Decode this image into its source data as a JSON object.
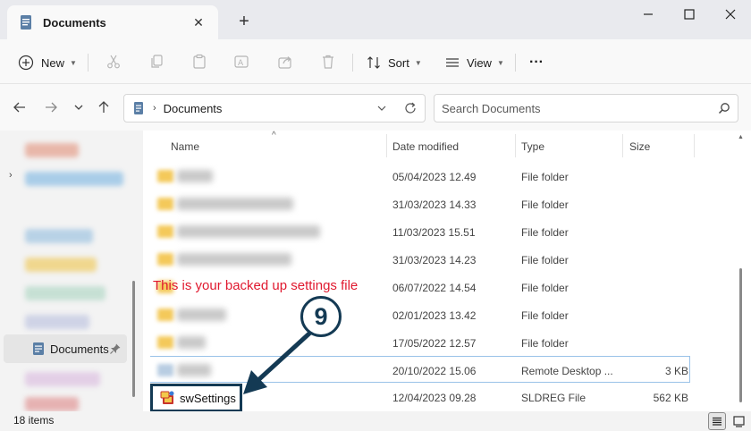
{
  "window": {
    "tab_title": "Documents",
    "close_tab_glyph": "✕",
    "new_tab_glyph": "+"
  },
  "toolbar": {
    "new_label": "New",
    "sort_label": "Sort",
    "view_label": "View",
    "more_glyph": "···"
  },
  "address": {
    "location": "Documents",
    "search_placeholder": "Search Documents"
  },
  "navpane": {
    "selected_label": "Documents"
  },
  "columns": {
    "name": "Name",
    "date_modified": "Date modified",
    "type": "Type",
    "size": "Size"
  },
  "rows": [
    {
      "date": "05/04/2023 12.49",
      "type": "File folder",
      "size": ""
    },
    {
      "date": "31/03/2023 14.33",
      "type": "File folder",
      "size": ""
    },
    {
      "date": "11/03/2023 15.51",
      "type": "File folder",
      "size": ""
    },
    {
      "date": "31/03/2023 14.23",
      "type": "File folder",
      "size": ""
    },
    {
      "date": "06/07/2022 14.54",
      "type": "File folder",
      "size": ""
    },
    {
      "date": "02/01/2023 13.42",
      "type": "File folder",
      "size": ""
    },
    {
      "date": "17/05/2022 12.57",
      "type": "File folder",
      "size": ""
    },
    {
      "date": "20/10/2022 15.06",
      "type": "Remote Desktop ...",
      "size": "3 KB"
    },
    {
      "date": "12/04/2023 09.28",
      "type": "SLDREG File",
      "size": "562 KB",
      "name": "swSettings"
    }
  ],
  "annotation": {
    "text": "This is your backed up settings file",
    "step_number": "9",
    "text_color": "#e0192f",
    "marker_color": "#143a54"
  },
  "status": {
    "item_count": "18 items"
  },
  "colors": {
    "folder": "#f4c95a",
    "selection_border": "#99c2e8"
  }
}
